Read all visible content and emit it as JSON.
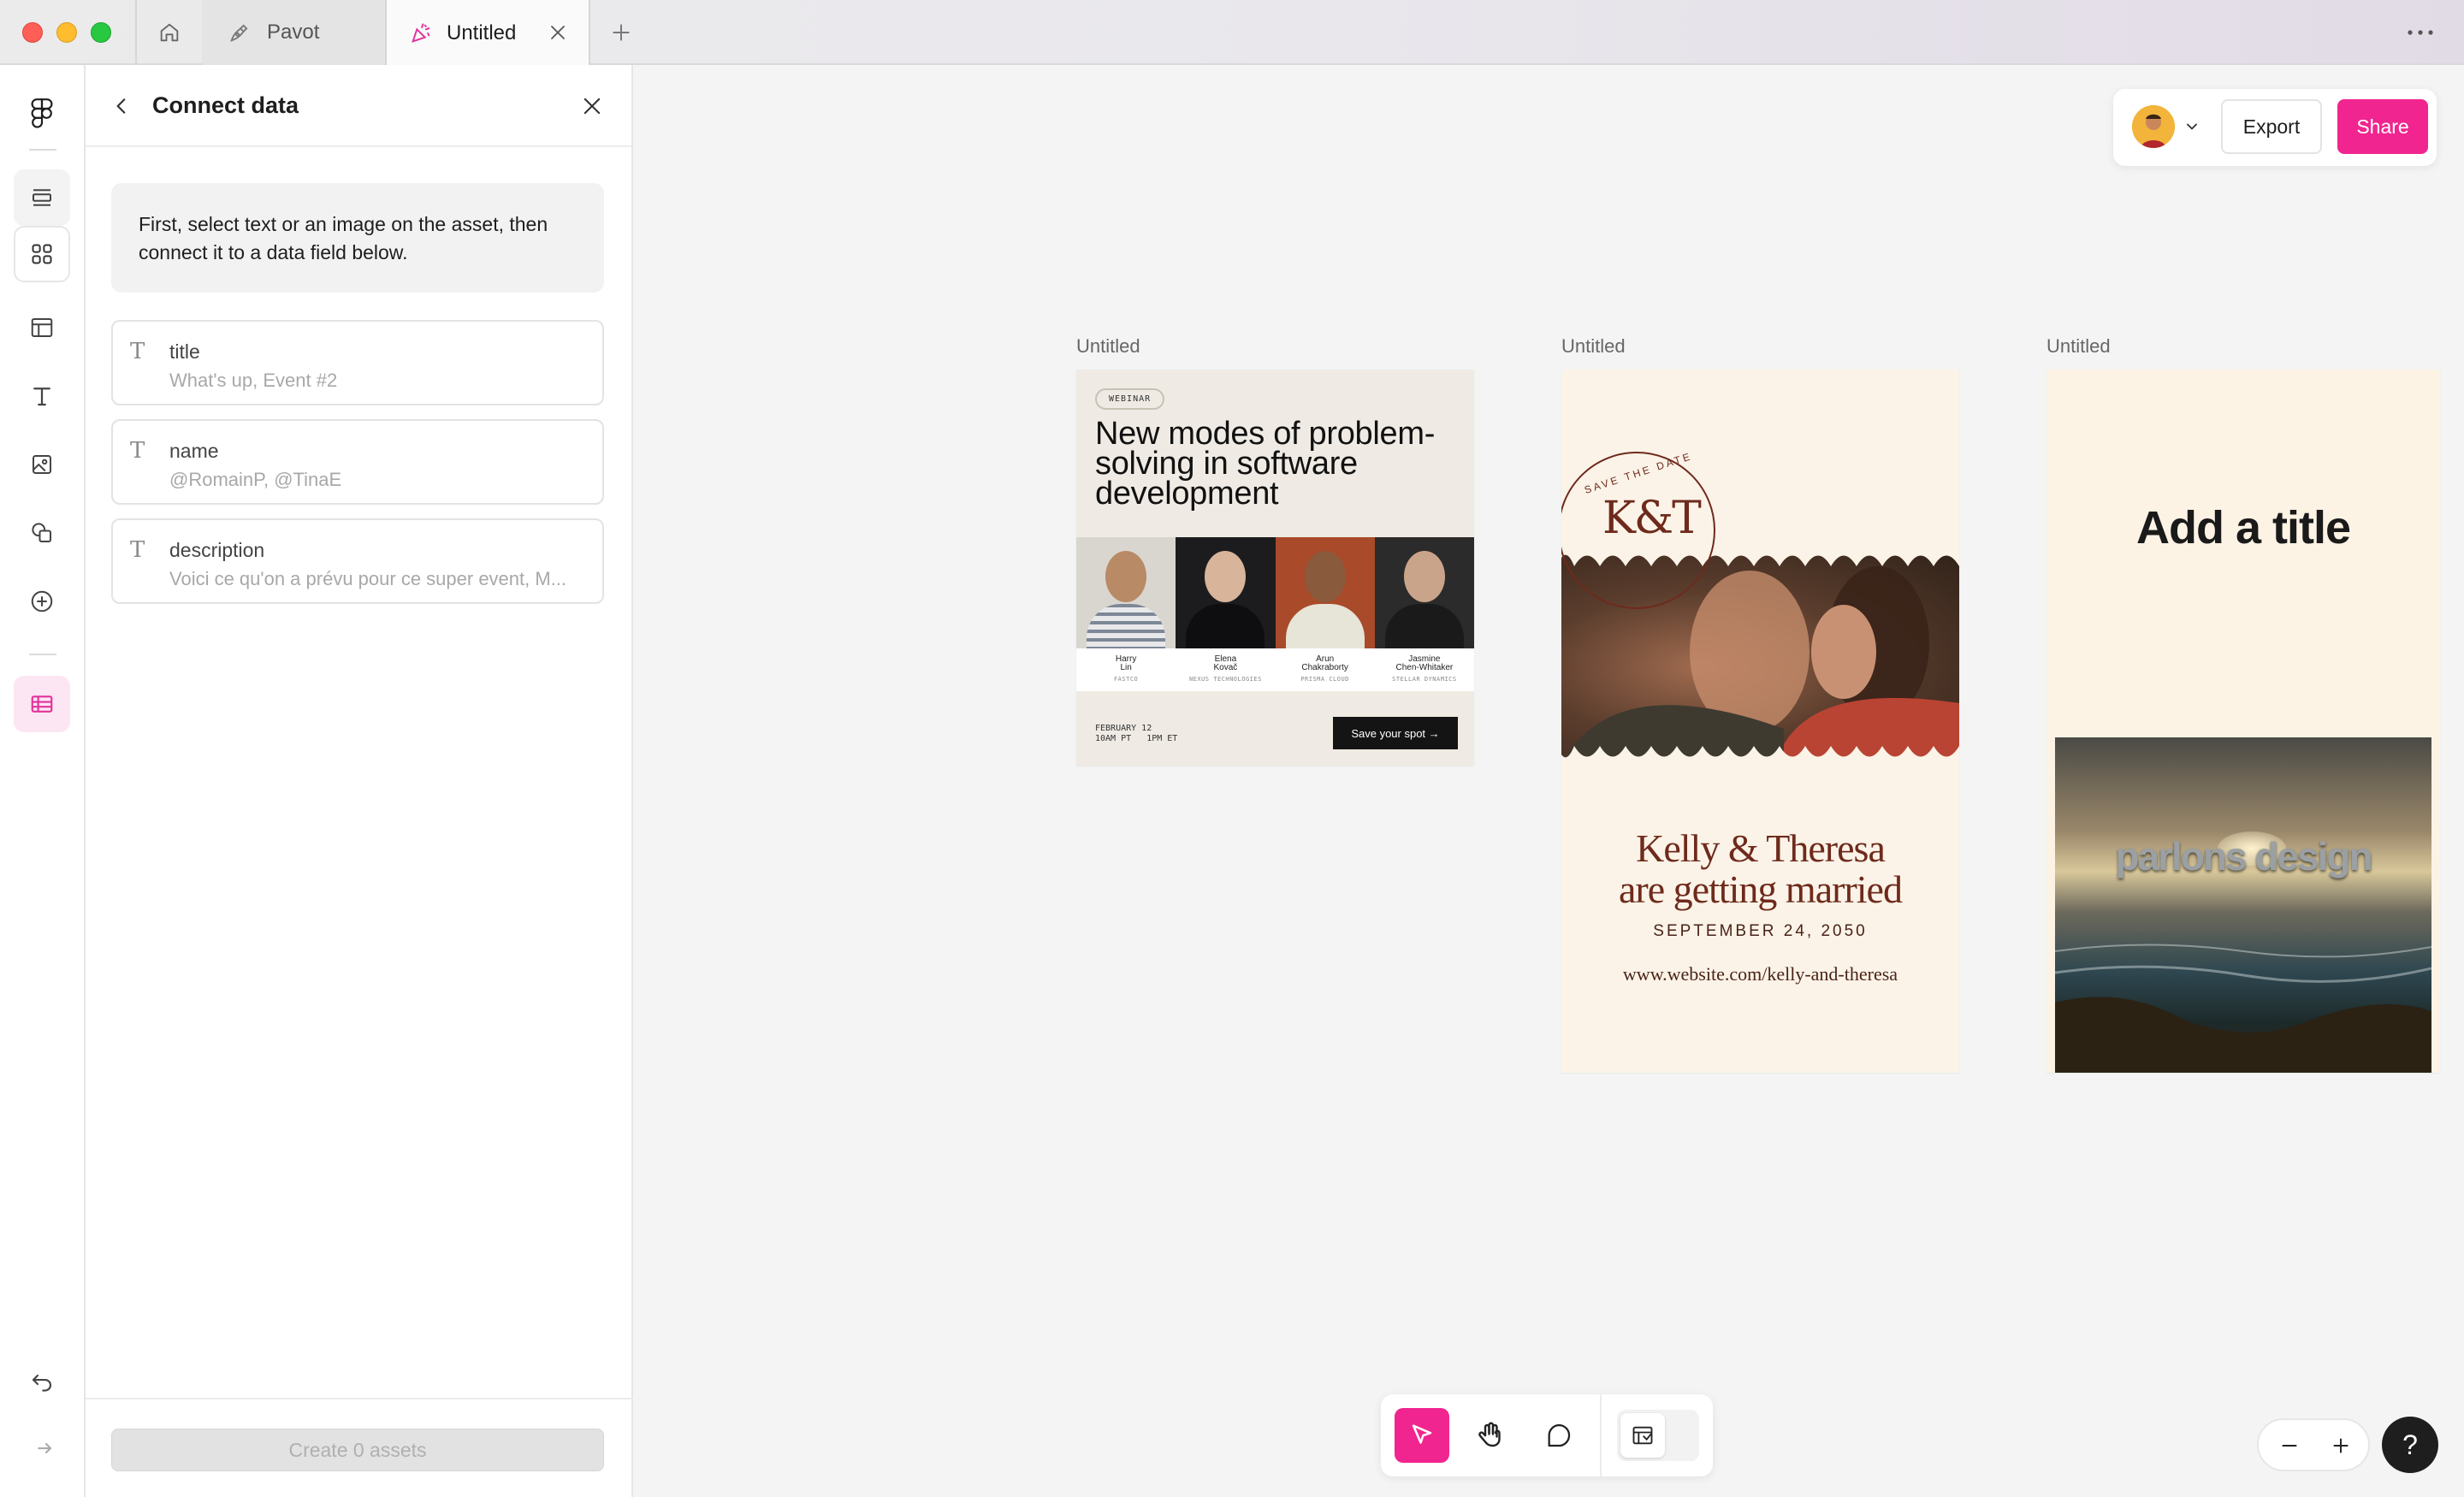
{
  "tabs": {
    "home_icon": "home-icon",
    "items": [
      {
        "label": "Pavot",
        "icon": "pen-icon"
      },
      {
        "label": "Untitled",
        "icon": "party-icon",
        "active": true
      }
    ]
  },
  "panel": {
    "title": "Connect data",
    "info": "First, select text or an image on the asset, then connect it to a data field below.",
    "fields": [
      {
        "name": "title",
        "value": "What's up, Event #2"
      },
      {
        "name": "name",
        "value": "@RomainP, @TinaE"
      },
      {
        "name": "description",
        "value": "Voici ce qu'on a prévu pour ce super event, M..."
      }
    ],
    "create_label": "Create 0 assets"
  },
  "actions": {
    "export_label": "Export",
    "share_label": "Share"
  },
  "frames": [
    {
      "label": "Untitled"
    },
    {
      "label": "Untitled"
    },
    {
      "label": "Untitled"
    }
  ],
  "webinar": {
    "badge": "WEBINAR",
    "title": "New modes of problem-solving in software development",
    "people": [
      {
        "name": "Harry\nLin",
        "company": "FASTCO"
      },
      {
        "name": "Elena\nKovač",
        "company": "NEXUS TECHNOLOGIES"
      },
      {
        "name": "Arun\nChakraborty",
        "company": "PRISMA CLOUD"
      },
      {
        "name": "Jasmine\nChen-Whitaker",
        "company": "STELLAR DYNAMICS"
      }
    ],
    "date": "FEBRUARY 12\n10AM PT   1PM ET",
    "cta": "Save your spot →"
  },
  "wedding": {
    "seal_text": "SAVE THE DATE",
    "monogram": "K&T",
    "names": "Kelly & Theresa\nare getting married",
    "date": "SEPTEMBER 24, 2050",
    "url": "www.website.com/kelly-and-theresa"
  },
  "poster": {
    "title": "Add a title",
    "overlay": "parlons design"
  },
  "colors": {
    "accent": "#f0258f",
    "wedding_ink": "#6e2a1c"
  }
}
